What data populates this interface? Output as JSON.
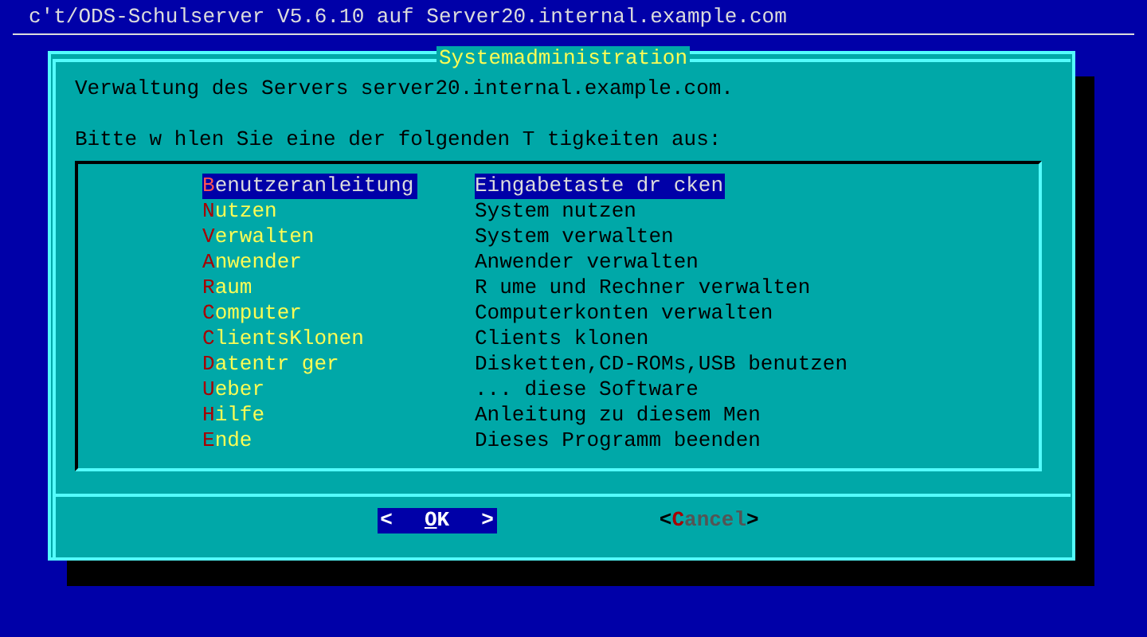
{
  "backtitle": "c't/ODS-Schulserver V5.6.10 auf Server20.internal.example.com",
  "dialog": {
    "title": "Systemadministration",
    "text_lines": [
      "Verwaltung des Servers server20.internal.example.com.",
      "Bitte w hlen Sie eine der folgenden T tigkeiten aus:"
    ],
    "menu": [
      {
        "tag": "Benutzeranleitung",
        "description": "Eingabetaste dr cken",
        "selected": true
      },
      {
        "tag": "Nutzen",
        "description": "System nutzen",
        "selected": false
      },
      {
        "tag": "Verwalten",
        "description": "System verwalten",
        "selected": false
      },
      {
        "tag": "Anwender",
        "description": "Anwender verwalten",
        "selected": false
      },
      {
        "tag": "Raum",
        "description": "R ume und Rechner verwalten",
        "selected": false
      },
      {
        "tag": "Computer",
        "description": "Computerkonten verwalten",
        "selected": false
      },
      {
        "tag": "ClientsKlonen",
        "description": "Clients klonen",
        "selected": false
      },
      {
        "tag": "Datentr ger",
        "description": "Disketten,CD-ROMs,USB benutzen",
        "selected": false
      },
      {
        "tag": "Ueber",
        "description": "... diese Software",
        "selected": false
      },
      {
        "tag": "Hilfe",
        "description": "Anleitung zu diesem Men",
        "selected": false
      },
      {
        "tag": "Ende",
        "description": "Dieses Programm beenden",
        "selected": false
      }
    ],
    "buttons": [
      {
        "left": "<",
        "label": "OK",
        "right": ">",
        "selected": true
      },
      {
        "left": "<",
        "label": "Cancel",
        "right": ">",
        "selected": false
      }
    ]
  }
}
